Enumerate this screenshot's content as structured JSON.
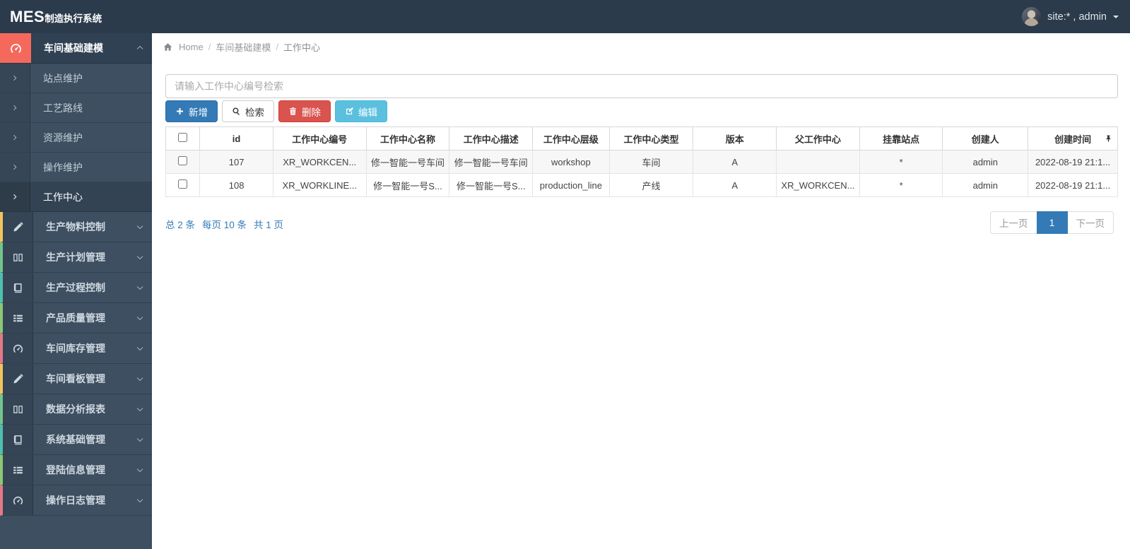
{
  "brand": {
    "bold": "MES",
    "rest": "制造执行系统"
  },
  "navbar": {
    "user_label": "site:* , admin"
  },
  "breadcrumb": {
    "home": "Home",
    "level1": "车间基础建模",
    "level2": "工作中心"
  },
  "search": {
    "placeholder": "请输入工作中心编号检索",
    "value": ""
  },
  "toolbar": {
    "add": "新增",
    "search": "检索",
    "delete": "删除",
    "edit": "编辑"
  },
  "sidebar": {
    "items": [
      {
        "label": "车间基础建模",
        "icon": "gauge-icon",
        "icon_bg": "#f4695c",
        "state": "expanded"
      },
      {
        "label": "站点维护"
      },
      {
        "label": "工艺路线"
      },
      {
        "label": "资源维护"
      },
      {
        "label": "操作维护"
      },
      {
        "label": "工作中心",
        "state": "active"
      },
      {
        "label": "生产物料控制",
        "icon": "pencil-icon",
        "accent": "#f3c35d"
      },
      {
        "label": "生产计划管理",
        "icon": "columns-icon",
        "accent": "#74c48c"
      },
      {
        "label": "生产过程控制",
        "icon": "book-icon",
        "accent": "#4fc0ae"
      },
      {
        "label": "产品质量管理",
        "icon": "list-icon",
        "accent": "#8bc873"
      },
      {
        "label": "车间库存管理",
        "icon": "gauge-icon",
        "accent": "#e77987"
      },
      {
        "label": "车间看板管理",
        "icon": "pencil-icon",
        "accent": "#f3c35d"
      },
      {
        "label": "数据分析报表",
        "icon": "columns-icon",
        "accent": "#74c48c"
      },
      {
        "label": "系统基础管理",
        "icon": "book-icon",
        "accent": "#4fc0ae"
      },
      {
        "label": "登陆信息管理",
        "icon": "list-icon",
        "accent": "#8bc873"
      },
      {
        "label": "操作日志管理",
        "icon": "gauge-icon",
        "accent": "#e77987"
      }
    ]
  },
  "table": {
    "headers": [
      "id",
      "工作中心编号",
      "工作中心名称",
      "工作中心描述",
      "工作中心层级",
      "工作中心类型",
      "版本",
      "父工作中心",
      "挂靠站点",
      "创建人",
      "创建时间"
    ],
    "rows": [
      [
        "107",
        "XR_WORKCEN...",
        "修一智能一号车间",
        "修一智能一号车间",
        "workshop",
        "车间",
        "A",
        "",
        "*",
        "admin",
        "2022-08-19 21:1..."
      ],
      [
        "108",
        "XR_WORKLINE...",
        "修一智能一号S...",
        "修一智能一号S...",
        "production_line",
        "产线",
        "A",
        "XR_WORKCEN...",
        "*",
        "admin",
        "2022-08-19 21:1..."
      ]
    ]
  },
  "pagination": {
    "summary_total": "总 2 条",
    "summary_per": "每页 10 条",
    "summary_pages": "共 1 页",
    "prev": "上一页",
    "page": "1",
    "next": "下一页"
  },
  "colors": {
    "navbar_bg": "#2c3b4c",
    "sidebar_bg": "#3d4f61",
    "primary": "#337ab7",
    "danger": "#d9534f",
    "info": "#5bc0de",
    "active_icon_bg": "#f4695c"
  }
}
